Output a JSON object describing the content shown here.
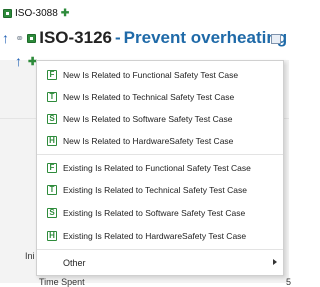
{
  "parent": {
    "id": "ISO-3088"
  },
  "title": {
    "id": "ISO-3126",
    "dash": "-",
    "text": "Prevent overheating"
  },
  "menu": {
    "items": [
      {
        "badge": "F",
        "label": "New Is Related to Functional Safety Test Case"
      },
      {
        "badge": "T",
        "label": "New Is Related to Technical Safety Test Case"
      },
      {
        "badge": "S",
        "label": "New Is Related to Software Safety Test Case"
      },
      {
        "badge": "H",
        "label": "New Is Related to HardwareSafety Test Case"
      },
      {
        "badge": "F",
        "label": "Existing Is Related to Functional Safety Test Case"
      },
      {
        "badge": "T",
        "label": "Existing Is Related to Technical Safety Test Case"
      },
      {
        "badge": "S",
        "label": "Existing Is Related to Software Safety Test Case"
      },
      {
        "badge": "H",
        "label": "Existing Is Related to HardwareSafety Test Case"
      }
    ],
    "other_label": "Other"
  },
  "background": {
    "ini_label": "Ini",
    "time_spent_label": "Time Spent",
    "right_cut": "5"
  },
  "colors": {
    "accent_green": "#2e8b3b",
    "title_blue": "#1f6aa8",
    "arrow_blue": "#1f5fb4"
  }
}
